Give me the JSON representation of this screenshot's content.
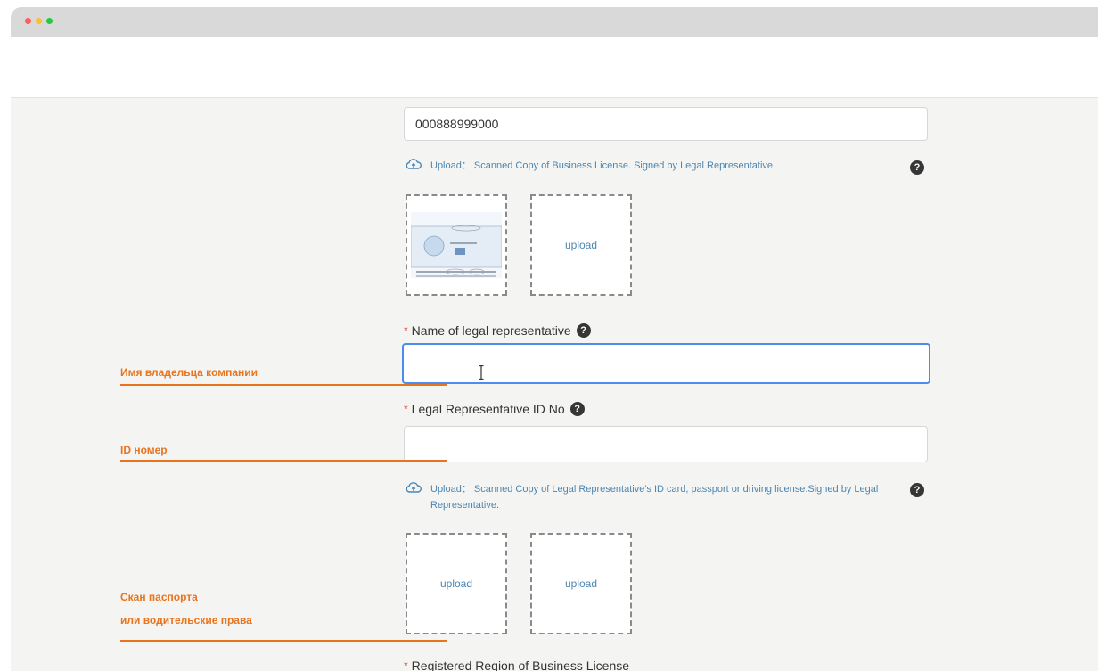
{
  "window": {
    "traffic_lights": [
      "close",
      "minimize",
      "maximize"
    ]
  },
  "form": {
    "license_number_value": "000888999000",
    "business_license_upload": {
      "label": "Upload：",
      "description": "Scanned Copy of Business License. Signed by Legal Representative.",
      "upload_box_label": "upload"
    },
    "legal_rep_name": {
      "required_mark": "*",
      "label": "Name of legal representative",
      "value": ""
    },
    "legal_rep_id": {
      "required_mark": "*",
      "label": "Legal Representative ID No",
      "value": ""
    },
    "id_upload": {
      "label": "Upload：",
      "description": "Scanned Copy of Legal Representative's ID card, passport or driving license.Signed by Legal Representative.",
      "upload_box_label_1": "upload",
      "upload_box_label_2": "upload"
    },
    "registered_region": {
      "required_mark": "*",
      "label": "Registered Region of Business License"
    }
  },
  "annotations": {
    "name_note": "Имя владельца компании",
    "id_note": "ID номер",
    "scan_note_line1": "Скан паспорта",
    "scan_note_line2": "или водительские права"
  },
  "colors": {
    "accent_orange": "#e8741e",
    "link_blue": "#4b86b3",
    "focus_blue": "#4a8df0",
    "required_red": "#e0402b"
  }
}
